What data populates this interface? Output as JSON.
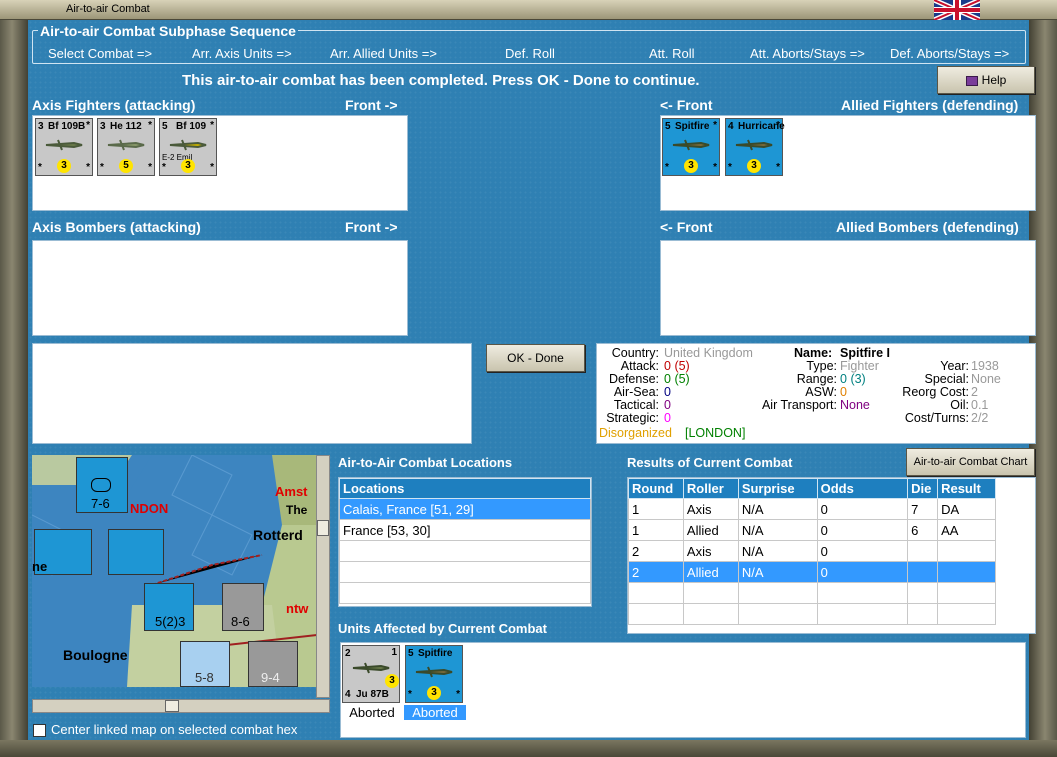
{
  "window": {
    "title": "Air-to-air Combat"
  },
  "sequence": {
    "legend": "Air-to-air Combat Subphase Sequence",
    "steps": [
      "Select Combat =>",
      "Arr. Axis Units =>",
      "Arr. Allied Units =>",
      "Def. Roll",
      "Att. Roll",
      "Att. Aborts/Stays =>",
      "Def. Aborts/Stays =>"
    ]
  },
  "status_message": "This air-to-air combat has been completed.  Press OK - Done to continue.",
  "help_button": "Help",
  "axis_fighters": {
    "label": "Axis Fighters (attacking)",
    "front": "Front ->",
    "units": [
      {
        "strength": "3",
        "name": "Bf 109B",
        "stars": "*",
        "value": "3",
        "sub": ""
      },
      {
        "strength": "3",
        "name": "He 112",
        "stars": "*",
        "value": "5",
        "sub": ""
      },
      {
        "strength": "5",
        "name": "Bf 109",
        "stars": "*",
        "value": "3",
        "sub": "E-2 Emil"
      }
    ]
  },
  "allied_fighters": {
    "label": "Allied Fighters (defending)",
    "front": "<- Front",
    "units": [
      {
        "strength": "5",
        "name": "Spitfire",
        "stars": "*",
        "value": "3"
      },
      {
        "strength": "4",
        "name": "Hurricane",
        "stars": "*",
        "value": "3"
      }
    ]
  },
  "axis_bombers": {
    "label": "Axis Bombers (attacking)",
    "front": "Front ->"
  },
  "allied_bombers": {
    "label": "Allied Bombers (defending)",
    "front": "<- Front"
  },
  "ok_button": "OK - Done",
  "unit_info": {
    "country_label": "Country:",
    "country": "United Kingdom",
    "name_label": "Name:",
    "name": "Spitfire I",
    "year_label": "Year:",
    "year": "1938",
    "attack_label": "Attack:",
    "attack": "0",
    "attack_paren": "(5)",
    "type_label": "Type:",
    "type": "Fighter",
    "special_label": "Special:",
    "special": "None",
    "defense_label": "Defense:",
    "defense": "0",
    "defense_paren": "(5)",
    "range_label": "Range:",
    "range": "0",
    "range_paren": "(3)",
    "reorg_label": "Reorg Cost:",
    "reorg": "2",
    "airsea_label": "Air-Sea:",
    "airsea": "0",
    "asw_label": "ASW:",
    "asw": "0",
    "oil_label": "Oil:",
    "oil": "0.1",
    "tactical_label": "Tactical:",
    "tactical": "0",
    "airtransport_label": "Air Transport:",
    "airtransport": "None",
    "costturns_label": "Cost/Turns:",
    "costturns": "2/2",
    "strategic_label": "Strategic:",
    "strategic": "0",
    "disorganized": "Disorganized",
    "location": "[LONDON]"
  },
  "map": {
    "labels": [
      "NDON",
      "Amst",
      "The",
      "Rotterd",
      "Boulogne",
      "ne",
      "ntw"
    ],
    "checkbox_label": "Center linked map on selected combat hex"
  },
  "locations": {
    "title": "Air-to-Air Combat Locations",
    "header": "Locations",
    "rows": [
      "Calais, France [51, 29]",
      "France [53, 30]"
    ],
    "selected": 0
  },
  "results": {
    "title": "Results of Current Combat",
    "chart_button": "Air-to-air Combat Chart",
    "columns": [
      "Round",
      "Roller",
      "Surprise",
      "Odds",
      "Die",
      "Result"
    ],
    "rows": [
      [
        "1",
        "Axis",
        "N/A",
        "0",
        "7",
        "DA"
      ],
      [
        "1",
        "Allied",
        "N/A",
        "0",
        "6",
        "AA"
      ],
      [
        "2",
        "Axis",
        "N/A",
        "0",
        "",
        ""
      ],
      [
        "2",
        "Allied",
        "N/A",
        "0",
        "",
        ""
      ]
    ],
    "selected": 3
  },
  "affected": {
    "title": "Units Affected by Current Combat",
    "units": [
      {
        "strength": "2",
        "name": "Ju 87B",
        "top": "1",
        "side": "4",
        "value": "3",
        "status": "Aborted"
      },
      {
        "strength": "5",
        "name": "Spitfire",
        "value": "3",
        "status": "Aborted"
      }
    ]
  },
  "colors": {
    "panel": "#2f80b3",
    "selection": "#3399ff",
    "axis_counter": "#c8c8c8",
    "allied_counter": "#1e96d4"
  }
}
